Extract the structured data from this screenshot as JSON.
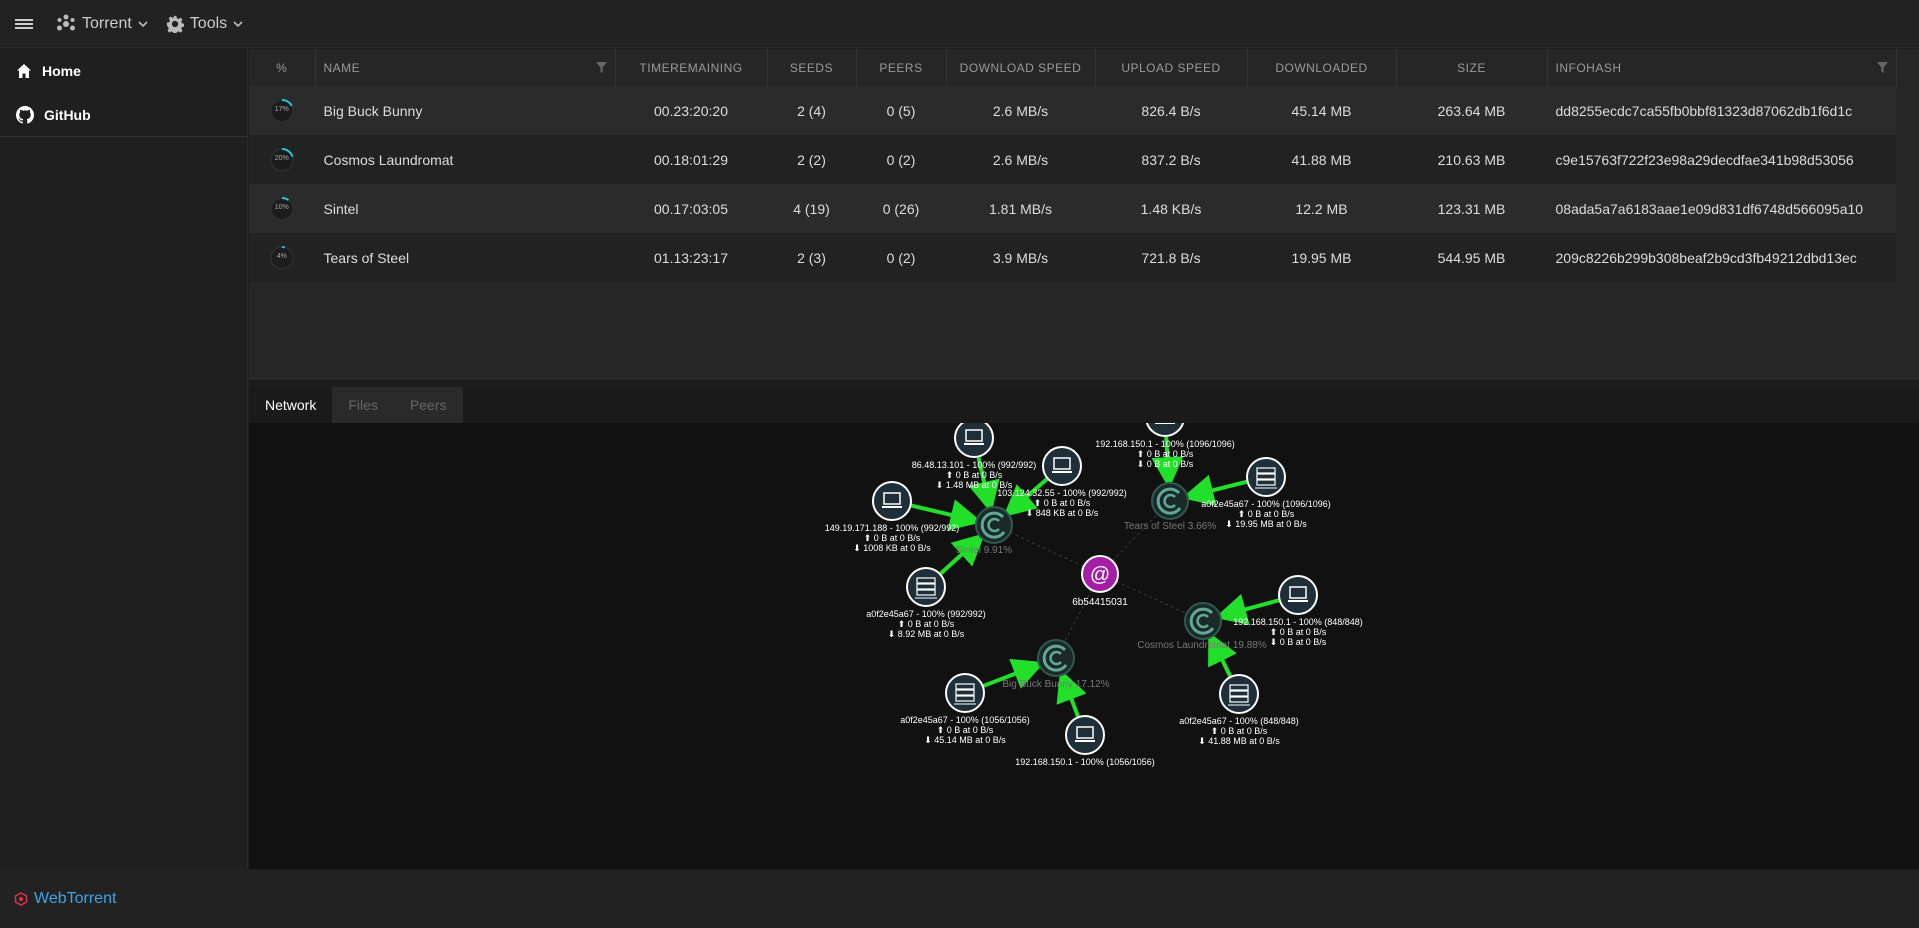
{
  "topbar": {
    "torrent_menu": "Torrent",
    "tools_menu": "Tools"
  },
  "sidebar": {
    "items": [
      {
        "label": "Home",
        "icon": "home-icon"
      },
      {
        "label": "GitHub",
        "icon": "github-icon"
      }
    ]
  },
  "table": {
    "columns": [
      "%",
      "NAME",
      "TIMEREMAINING",
      "SEEDS",
      "PEERS",
      "DOWNLOAD SPEED",
      "UPLOAD SPEED",
      "DOWNLOADED",
      "SIZE",
      "INFOHASH"
    ],
    "rows": [
      {
        "progress": 0.17,
        "progress_label": "17%",
        "name": "Big Buck Bunny",
        "time": "00.23:20:20",
        "seeds": "2 (4)",
        "peers": "0 (5)",
        "down": "2.6 MB/s",
        "up": "826.4 B/s",
        "downloaded": "45.14 MB",
        "size": "263.64 MB",
        "hash": "dd8255ecdc7ca55fb0bbf81323d87062db1f6d1c"
      },
      {
        "progress": 0.2,
        "progress_label": "20%",
        "name": "Cosmos Laundromat",
        "time": "00.18:01:29",
        "seeds": "2 (2)",
        "peers": "0 (2)",
        "down": "2.6 MB/s",
        "up": "837.2 B/s",
        "downloaded": "41.88 MB",
        "size": "210.63 MB",
        "hash": "c9e15763f722f23e98a29decdfae341b98d53056"
      },
      {
        "progress": 0.1,
        "progress_label": "10%",
        "name": "Sintel",
        "time": "00.17:03:05",
        "seeds": "4 (19)",
        "peers": "0 (26)",
        "down": "1.81 MB/s",
        "up": "1.48 KB/s",
        "downloaded": "12.2 MB",
        "size": "123.31 MB",
        "hash": "08ada5a7a6183aae1e09d831df6748d566095a10"
      },
      {
        "progress": 0.04,
        "progress_label": "4%",
        "name": "Tears of Steel",
        "time": "01.13:23:17",
        "seeds": "2 (3)",
        "peers": "0 (2)",
        "down": "3.9 MB/s",
        "up": "721.8 B/s",
        "downloaded": "19.95 MB",
        "size": "544.95 MB",
        "hash": "209c8226b299b308beaf2b9cd3fb49212dbd13ec"
      }
    ]
  },
  "tabs": [
    "Network",
    "Files",
    "Peers"
  ],
  "network": {
    "center_label": "6b54415031",
    "torrents": {
      "sintel": "Sintel 9.91%",
      "tears": "Tears of Steel 3.66%",
      "cosmos": "Cosmos Laundromat 19.88%",
      "bbb": "Big Buck Bunny 17.12%"
    },
    "peers": {
      "p1": [
        "86.48.13.101 - 100% (992/992)",
        "⬆ 0 B at 0 B/s",
        "⬇ 1.48 MB at 0 B/s"
      ],
      "p2": [
        "103.124.32.55 - 100% (992/992)",
        "⬆ 0 B at 0 B/s",
        "⬇ 848 KB at 0 B/s"
      ],
      "p3": [
        "149.19.171.188 - 100% (992/992)",
        "⬆ 0 B at 0 B/s",
        "⬇ 1008 KB at 0 B/s"
      ],
      "p4": [
        "a0f2e45a67 - 100% (992/992)",
        "⬆ 0 B at 0 B/s",
        "⬇ 8.92 MB at 0 B/s"
      ],
      "p5": [
        "192.168.150.1 - 100% (1096/1096)",
        "⬆ 0 B at 0 B/s",
        "⬇ 0 B at 0 B/s"
      ],
      "p6": [
        "a0f2e45a67 - 100% (1096/1096)",
        "⬆ 0 B at 0 B/s",
        "⬇ 19.95 MB at 0 B/s"
      ],
      "p7": [
        "192.168.150.1 - 100% (848/848)",
        "⬆ 0 B at 0 B/s",
        "⬇ 0 B at 0 B/s"
      ],
      "p8": [
        "a0f2e45a67 - 100% (848/848)",
        "⬆ 0 B at 0 B/s",
        "⬇ 41.88 MB at 0 B/s"
      ],
      "p9": [
        "a0f2e45a67 - 100% (1056/1056)",
        "⬆ 0 B at 0 B/s",
        "⬇ 45.14 MB at 0 B/s"
      ],
      "p10": [
        "192.168.150.1 - 100% (1056/1056)"
      ]
    }
  },
  "footer": {
    "brand": "WebTorrent"
  },
  "colors": {
    "accent": "#26c6da",
    "edge": "#22e02a",
    "link": "#3aa4e8",
    "center": "#a41fa6"
  }
}
